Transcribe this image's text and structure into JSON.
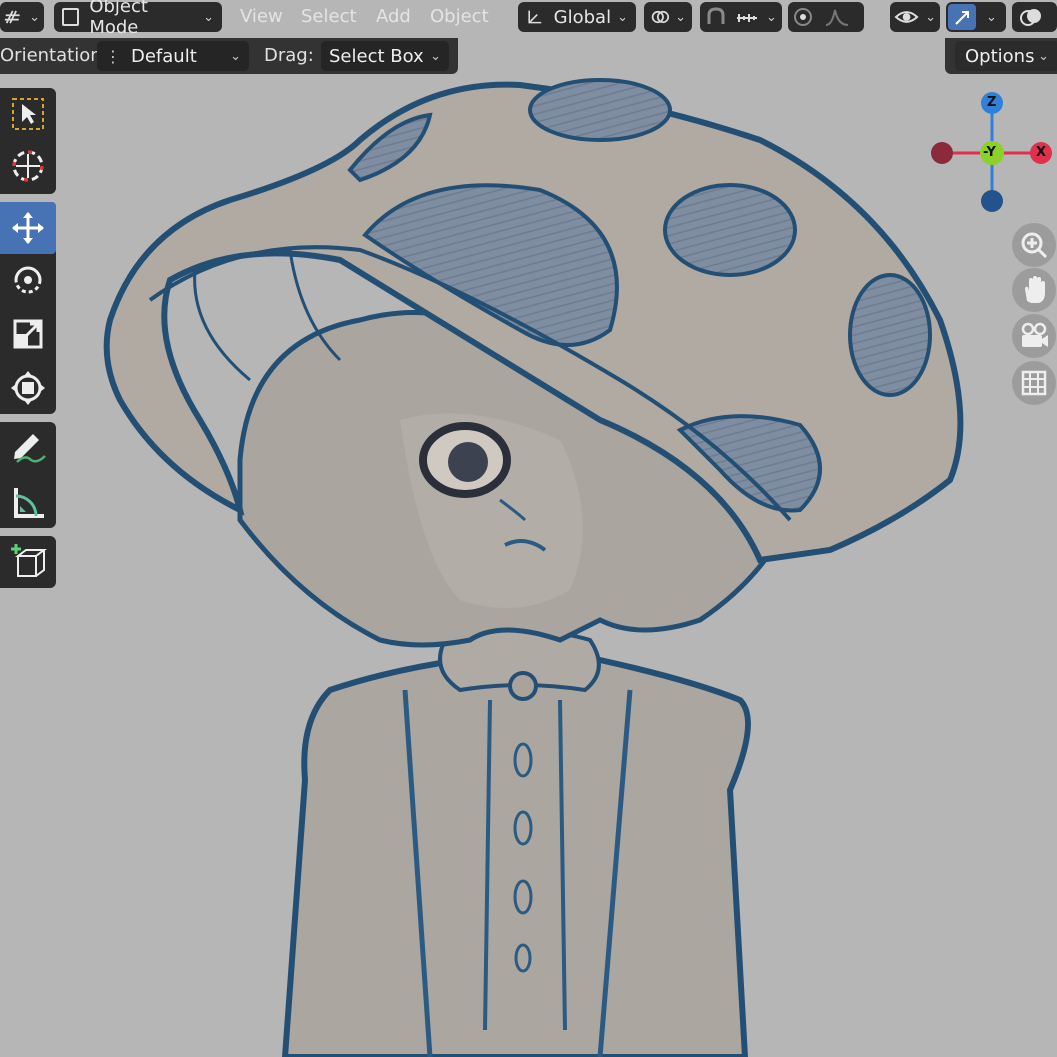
{
  "header": {
    "mode_label": "Object Mode",
    "menus": [
      "View",
      "Select",
      "Add",
      "Object"
    ],
    "transform_orientation": "Global"
  },
  "tool_settings": {
    "orientation_label": "Orientation:",
    "orientation_value": "Default",
    "drag_label": "Drag:",
    "drag_value": "Select Box",
    "options_label": "Options"
  },
  "gizmo": {
    "z_label": "Z",
    "y_label": "-Y",
    "x_label": "X"
  },
  "colors": {
    "active_tool": "#4772b3",
    "header_bg": "#2b2b2b",
    "viewport_bg": "#b6b6b6",
    "axis_x": "#e0304e",
    "axis_y": "#8bd12a",
    "axis_z": "#2f80d8"
  }
}
